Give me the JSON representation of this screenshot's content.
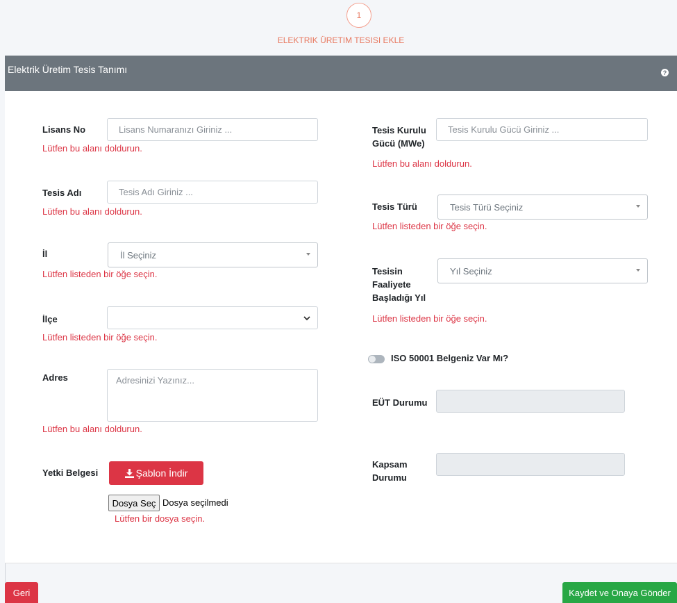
{
  "wizard": {
    "step_number": "1",
    "step_title": "ELEKTRIK ÜRETIM TESISI EKLE"
  },
  "card": {
    "title": "Elektrik Üretim Tesis Tanımı",
    "help_icon": "question-circle-icon"
  },
  "left": {
    "license": {
      "label": "Lisans No",
      "placeholder": "Lisans Numaranızı Giriniz ...",
      "value": "",
      "error": "Lütfen bu alanı doldurun."
    },
    "facility_name": {
      "label": "Tesis Adı",
      "placeholder": "Tesis Adı Giriniz ...",
      "value": "",
      "error": "Lütfen bu alanı doldurun."
    },
    "province": {
      "label": "İl",
      "selected": "İl Seçiniz",
      "error": "Lütfen listeden bir öğe seçin."
    },
    "district": {
      "label": "İlçe",
      "selected": "",
      "error": "Lütfen listeden bir öğe seçin."
    },
    "address": {
      "label": "Adres",
      "placeholder": "Adresinizi Yazınız...",
      "value": "",
      "error": "Lütfen bu alanı doldurun."
    },
    "authorization": {
      "label": "Yetki Belgesi",
      "download_label": "Şablon İndir",
      "file_button": "Dosya Seç",
      "file_status": "Dosya seçilmedi",
      "error": "Lütfen bir dosya seçin."
    }
  },
  "right": {
    "capacity": {
      "label_line1": "Tesis Kurulu",
      "label_line2": "Gücü (MWe)",
      "placeholder": "Tesis Kurulu Gücü Giriniz ...",
      "value": "",
      "error": "Lütfen bu alanı doldurun."
    },
    "facility_type": {
      "label": "Tesis Türü",
      "selected": "Tesis Türü Seçiniz",
      "error": "Lütfen listeden bir öğe seçin."
    },
    "start_year": {
      "label_line1": "Tesisin",
      "label_line2": "Faaliyete",
      "label_line3": "Başladığı Yıl",
      "selected": "Yıl Seçiniz",
      "error": "Lütfen listeden bir öğe seçin."
    },
    "iso": {
      "label": "ISO 50001 Belgeniz Var Mı?",
      "checked": false
    },
    "eut_status": {
      "label": "EÜT Durumu",
      "value": ""
    },
    "scope_status": {
      "label_line1": "Kapsam",
      "label_line2": "Durumu",
      "value": ""
    }
  },
  "footer": {
    "back_label": "Geri",
    "submit_label": "Kaydet ve Onaya Gönder"
  },
  "colors": {
    "error": "#dc3545",
    "header": "#6c757d",
    "success": "#28a745",
    "accent": "#e8785f"
  }
}
